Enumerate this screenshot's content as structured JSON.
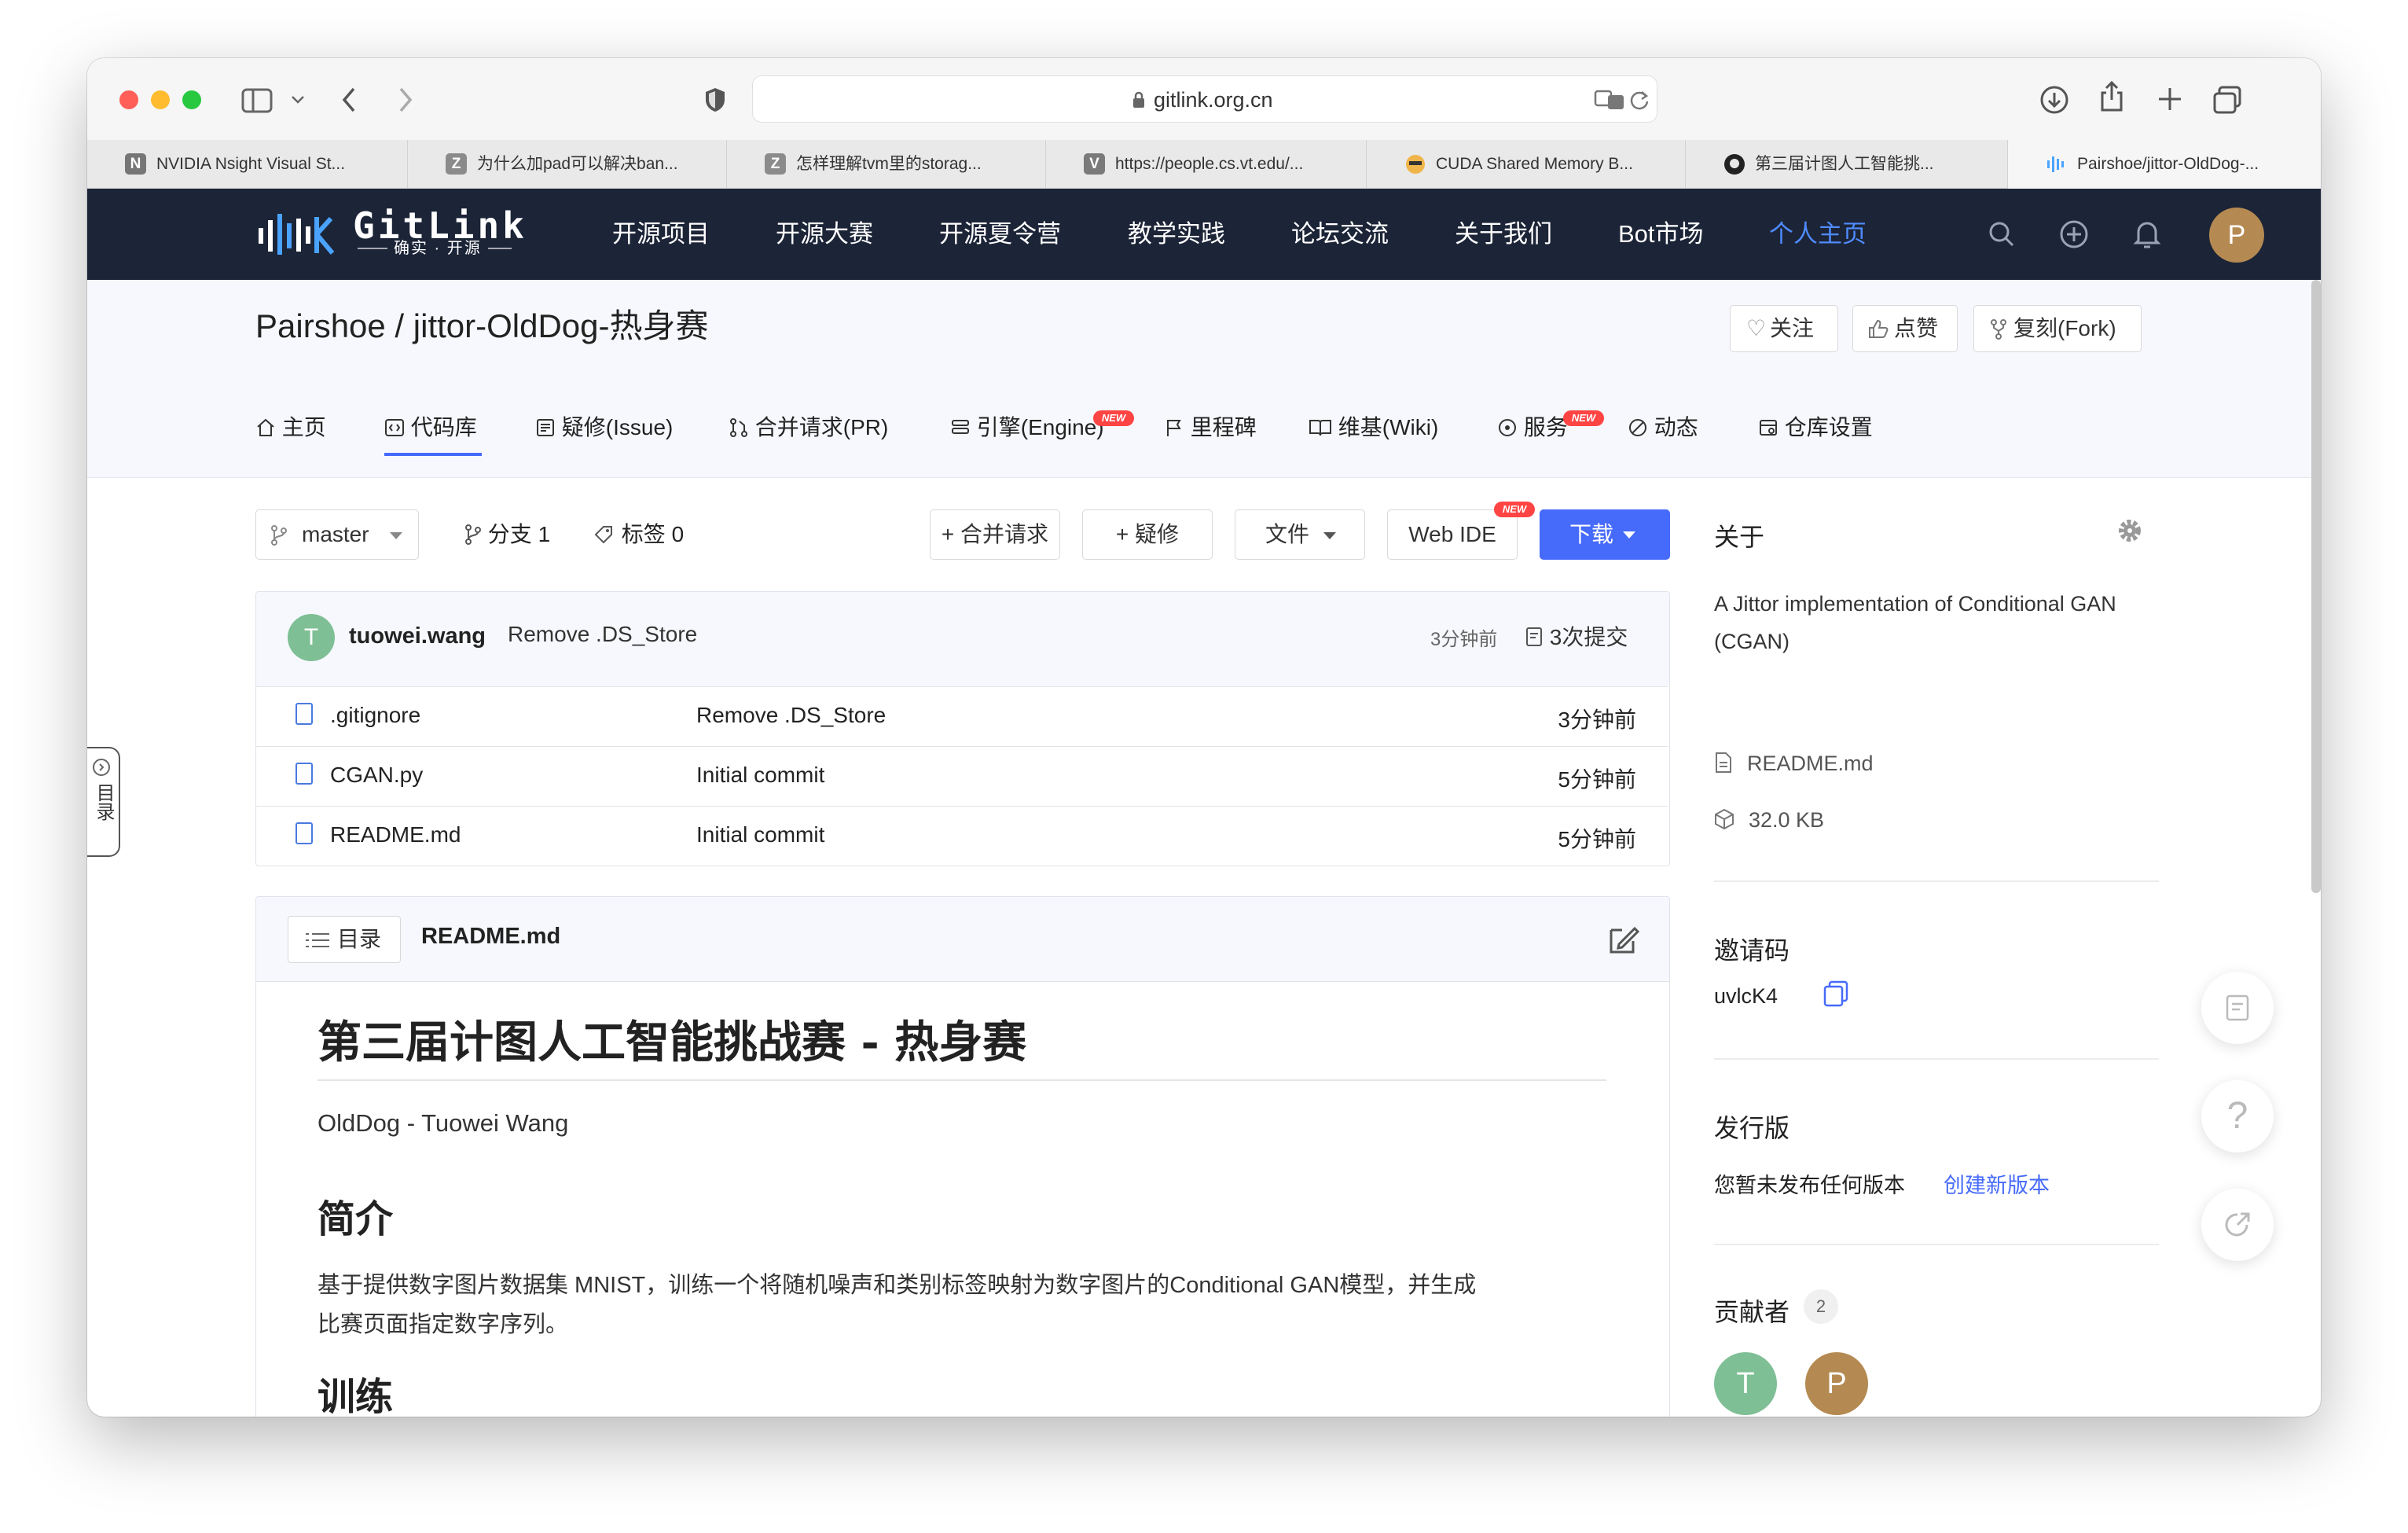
{
  "browser": {
    "url": "gitlink.org.cn",
    "tabs": [
      {
        "title": "NVIDIA Nsight Visual St...",
        "favicon_letter": "N",
        "favicon_color": "#767676"
      },
      {
        "title": "为什么加pad可以解决ban...",
        "favicon_letter": "Z",
        "favicon_color": "#8b8b8b"
      },
      {
        "title": "怎样理解tvm里的storag...",
        "favicon_letter": "Z",
        "favicon_color": "#8b8b8b"
      },
      {
        "title": "https://people.cs.vt.edu/...",
        "favicon_letter": "V",
        "favicon_color": "#7a7a7a"
      },
      {
        "title": "CUDA Shared Memory B...",
        "favicon_letter": "",
        "favicon_color": "#c98a2e"
      },
      {
        "title": "第三届计图人工智能挑...",
        "favicon_letter": "",
        "favicon_color": "#222222"
      },
      {
        "title": "Pairshoe/jittor-OldDog-...",
        "favicon_letter": "",
        "favicon_color": "#4aa3ff"
      }
    ]
  },
  "site": {
    "logo_text": "GitLink",
    "logo_sub": "确实 · 开源",
    "nav": [
      "开源项目",
      "开源大赛",
      "开源夏令营",
      "教学实践",
      "论坛交流",
      "关于我们",
      "Bot市场",
      "个人主页"
    ],
    "avatar_letter": "P"
  },
  "repo": {
    "owner": "Pairshoe",
    "separator": " / ",
    "name": "jittor-OldDog-热身赛",
    "actions": {
      "watch": "关注",
      "star": "点赞",
      "fork": "复刻(Fork)"
    },
    "tabs": [
      {
        "label": "主页",
        "icon": "home-icon"
      },
      {
        "label": "代码库",
        "icon": "code-icon",
        "active": true
      },
      {
        "label": "疑修(Issue)",
        "icon": "issue-icon"
      },
      {
        "label": "合并请求(PR)",
        "icon": "pull-request-icon"
      },
      {
        "label": "引擎(Engine)",
        "icon": "engine-icon",
        "badge": "NEW"
      },
      {
        "label": "里程碑",
        "icon": "flag-icon"
      },
      {
        "label": "维基(Wiki)",
        "icon": "book-icon"
      },
      {
        "label": "服务",
        "icon": "service-icon",
        "badge": "NEW"
      },
      {
        "label": "动态",
        "icon": "activity-icon"
      },
      {
        "label": "仓库设置",
        "icon": "settings-icon"
      }
    ]
  },
  "code": {
    "branch": "master",
    "branches_label": "分支",
    "branches_count": "1",
    "tags_label": "标签",
    "tags_count": "0",
    "new_pr": "+ 合并请求",
    "new_issue": "+ 疑修",
    "file_menu": "文件",
    "web_ide": "Web IDE",
    "web_ide_badge": "NEW",
    "download": "下载",
    "last_commit": {
      "avatar_letter": "T",
      "author": "tuowei.wang",
      "message": "Remove .DS_Store",
      "time": "3分钟前",
      "commits": "3次提交"
    },
    "files": [
      {
        "name": ".gitignore",
        "message": "Remove .DS_Store",
        "time": "3分钟前"
      },
      {
        "name": "CGAN.py",
        "message": "Initial commit",
        "time": "5分钟前"
      },
      {
        "name": "README.md",
        "message": "Initial commit",
        "time": "5分钟前"
      }
    ]
  },
  "readme": {
    "toc": "目录",
    "filename": "README.md",
    "h1": "第三届计图人工智能挑战赛 - 热身赛",
    "author_line": "OldDog - Tuowei Wang",
    "h2_intro": "简介",
    "intro_line1": "基于提供数字图片数据集 MNIST，训练一个将随机噪声和类别标签映射为数字图片的Conditional GAN模型，并生成",
    "intro_line2": "比赛页面指定数字序列。",
    "h2_train": "训练"
  },
  "sidebar": {
    "about_title": "关于",
    "description_line1": "A Jittor implementation of Conditional GAN",
    "description_line2": "(CGAN)",
    "readme_link": "README.md",
    "size": "32.0 KB",
    "invite_title": "邀请码",
    "invite_code": "uvlcK4",
    "release_title": "发行版",
    "release_empty": "您暂未发布任何版本",
    "release_create": "创建新版本",
    "contributors_title": "贡献者",
    "contributors_count": "2",
    "contributors": [
      {
        "letter": "T",
        "color": "#7fbf95"
      },
      {
        "letter": "P",
        "color": "#b48a52"
      }
    ]
  },
  "left_toc_tab": "目录",
  "colors": {
    "nav_bg": "#1c2437",
    "accent": "#466afa",
    "active_nav": "#4f8cff",
    "new_badge": "#ff4444"
  }
}
